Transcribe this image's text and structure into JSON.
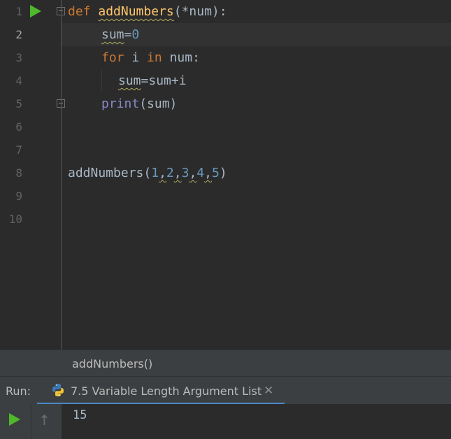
{
  "editor": {
    "line_numbers": [
      "1",
      "2",
      "3",
      "4",
      "5",
      "6",
      "7",
      "8",
      "9",
      "10"
    ],
    "current_line": "2",
    "code": {
      "l1_def": "def",
      "l1_name": "addNumbers",
      "l1_params": "(*num):",
      "l2_sum": "sum",
      "l2_eq": "=",
      "l2_zero": "0",
      "l3_for": "for",
      "l3_i": " i ",
      "l3_in": "in",
      "l3_rest": " num:",
      "l4_sum": "sum",
      "l4_rest": "=sum+i",
      "l5_print": "print",
      "l5_rest": "(sum)",
      "l8_call": "addNumbers(",
      "l8_a1": "1",
      "l8_c1": ",",
      "l8_a2": "2",
      "l8_c2": ",",
      "l8_a3": "3",
      "l8_c3": ",",
      "l8_a4": "4",
      "l8_c4": ",",
      "l8_a5": "5",
      "l8_close": ")"
    }
  },
  "breadcrumb": {
    "label": "addNumbers()"
  },
  "run_panel": {
    "label": "Run:",
    "tab_label": "7.5 Variable Length Argument List",
    "close_glyph": "✕",
    "up_glyph": "↑",
    "output": "15"
  },
  "colors": {
    "background": "#2b2b2b",
    "keyword": "#cc7832",
    "function": "#ffc66d",
    "number": "#6897bb",
    "builtin": "#8888c6",
    "run_green": "#4fb82b",
    "tab_underline": "#4a88c7"
  },
  "icons": [
    "run-gutter-icon",
    "fold-icon",
    "python-icon",
    "close-icon",
    "rerun-icon",
    "scroll-up-icon"
  ]
}
